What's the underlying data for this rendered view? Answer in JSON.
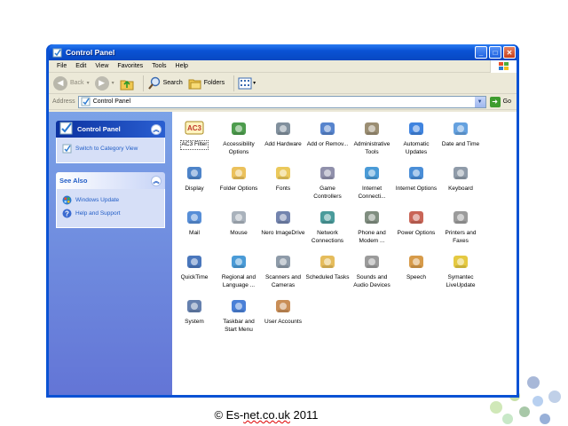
{
  "window": {
    "title": "Control Panel",
    "minimize": "_",
    "maximize": "□",
    "close": "✕"
  },
  "menu": [
    "File",
    "Edit",
    "View",
    "Favorites",
    "Tools",
    "Help"
  ],
  "toolbar": {
    "back": "Back",
    "search": "Search",
    "folders": "Folders"
  },
  "address": {
    "label": "Address",
    "value": "Control Panel",
    "go": "Go"
  },
  "taskpane": {
    "control_panel_title": "Control Panel",
    "switch_link": "Switch to Category View",
    "see_also_title": "See Also",
    "windows_update": "Windows Update",
    "help_support": "Help and Support"
  },
  "items": [
    {
      "label": "AC3 Filter",
      "icon": "ac3-filter-icon",
      "color": "#c0392b"
    },
    {
      "label": "Accessibility Options",
      "icon": "accessibility-icon",
      "color": "#2e8b2e"
    },
    {
      "label": "Add Hardware",
      "icon": "hardware-icon",
      "color": "#6b7d8c"
    },
    {
      "label": "Add or Remov...",
      "icon": "add-remove-icon",
      "color": "#3a6fc4"
    },
    {
      "label": "Administrative Tools",
      "icon": "admin-tools-icon",
      "color": "#8a7a5a"
    },
    {
      "label": "Automatic Updates",
      "icon": "windows-update-icon",
      "color": "#1e6fd9"
    },
    {
      "label": "Date and Time",
      "icon": "clock-icon",
      "color": "#4a90d9"
    },
    {
      "label": "Display",
      "icon": "display-icon",
      "color": "#2f6fbf"
    },
    {
      "label": "Folder Options",
      "icon": "folder-options-icon",
      "color": "#e8b640"
    },
    {
      "label": "Fonts",
      "icon": "fonts-icon",
      "color": "#e8c040"
    },
    {
      "label": "Game Controllers",
      "icon": "gamepad-icon",
      "color": "#7d7d9c"
    },
    {
      "label": "Internet Connecti...",
      "icon": "internet-connection-icon",
      "color": "#2a8ad0"
    },
    {
      "label": "Internet Options",
      "icon": "internet-options-icon",
      "color": "#2a7ad0"
    },
    {
      "label": "Keyboard",
      "icon": "keyboard-icon",
      "color": "#7b8a9a"
    },
    {
      "label": "Mail",
      "icon": "mail-icon",
      "color": "#3a7ad0"
    },
    {
      "label": "Mouse",
      "icon": "mouse-icon",
      "color": "#9aa4b0"
    },
    {
      "label": "Nero ImageDrive",
      "icon": "nero-icon",
      "color": "#5a6fa0"
    },
    {
      "label": "Network Connections",
      "icon": "network-icon",
      "color": "#2a8a8a"
    },
    {
      "label": "Phone and Modem ...",
      "icon": "phone-icon",
      "color": "#6a7a6a"
    },
    {
      "label": "Power Options",
      "icon": "power-icon",
      "color": "#c04a3a"
    },
    {
      "label": "Printers and Faxes",
      "icon": "printer-icon",
      "color": "#8a8a8a"
    },
    {
      "label": "QuickTime",
      "icon": "quicktime-icon",
      "color": "#2a5fb0"
    },
    {
      "label": "Regional and Language ...",
      "icon": "globe-icon",
      "color": "#2a8ad0"
    },
    {
      "label": "Scanners and Cameras",
      "icon": "scanner-icon",
      "color": "#7a8a9a"
    },
    {
      "label": "Scheduled Tasks",
      "icon": "scheduled-tasks-icon",
      "color": "#e0b040"
    },
    {
      "label": "Sounds and Audio Devices",
      "icon": "speaker-icon",
      "color": "#8a8a8a"
    },
    {
      "label": "Speech",
      "icon": "speech-icon",
      "color": "#d08a2a"
    },
    {
      "label": "Symantec LiveUpdate",
      "icon": "symantec-icon",
      "color": "#e0c020"
    },
    {
      "label": "System",
      "icon": "system-icon",
      "color": "#4a6aa0"
    },
    {
      "label": "Taskbar and Start Menu",
      "icon": "taskbar-icon",
      "color": "#2a6ad0"
    },
    {
      "label": "User Accounts",
      "icon": "user-accounts-icon",
      "color": "#c07a3a"
    }
  ],
  "footer": {
    "prefix": "© Es-",
    "squiggle": "net.co.uk",
    "suffix": " 2011"
  }
}
